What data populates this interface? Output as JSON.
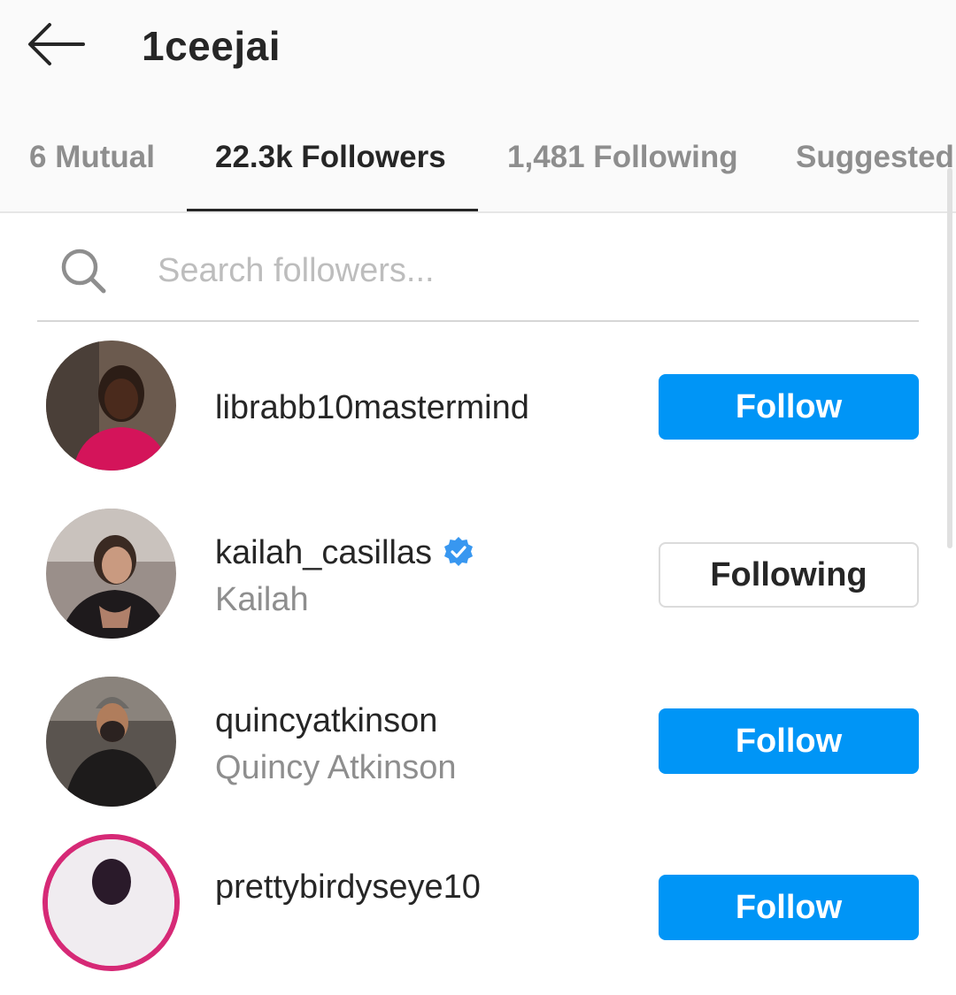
{
  "header": {
    "back_icon": "arrow-left-icon",
    "title": "1ceejai"
  },
  "tabs": [
    {
      "label": "6 Mutual",
      "active": false
    },
    {
      "label": "22.3k Followers",
      "active": true
    },
    {
      "label": "1,481 Following",
      "active": false
    },
    {
      "label": "Suggested",
      "active": false
    }
  ],
  "search": {
    "icon": "search-icon",
    "placeholder": "Search followers..."
  },
  "users": [
    {
      "username": "librabb10mastermind",
      "full_name": "",
      "verified": false,
      "button": "Follow"
    },
    {
      "username": "kailah_casillas",
      "full_name": "Kailah",
      "verified": true,
      "button": "Following"
    },
    {
      "username": "quincyatkinson",
      "full_name": "Quincy Atkinson",
      "verified": false,
      "button": "Follow"
    },
    {
      "username": "prettybirdyseye10",
      "full_name": "",
      "verified": false,
      "button": "Follow"
    }
  ],
  "colors": {
    "accent": "#0095f6",
    "text": "#262626",
    "secondary_text": "#8e8e8e",
    "header_bg": "#fafafa",
    "verified": "#3897f0",
    "story_ring": "#d62976"
  }
}
